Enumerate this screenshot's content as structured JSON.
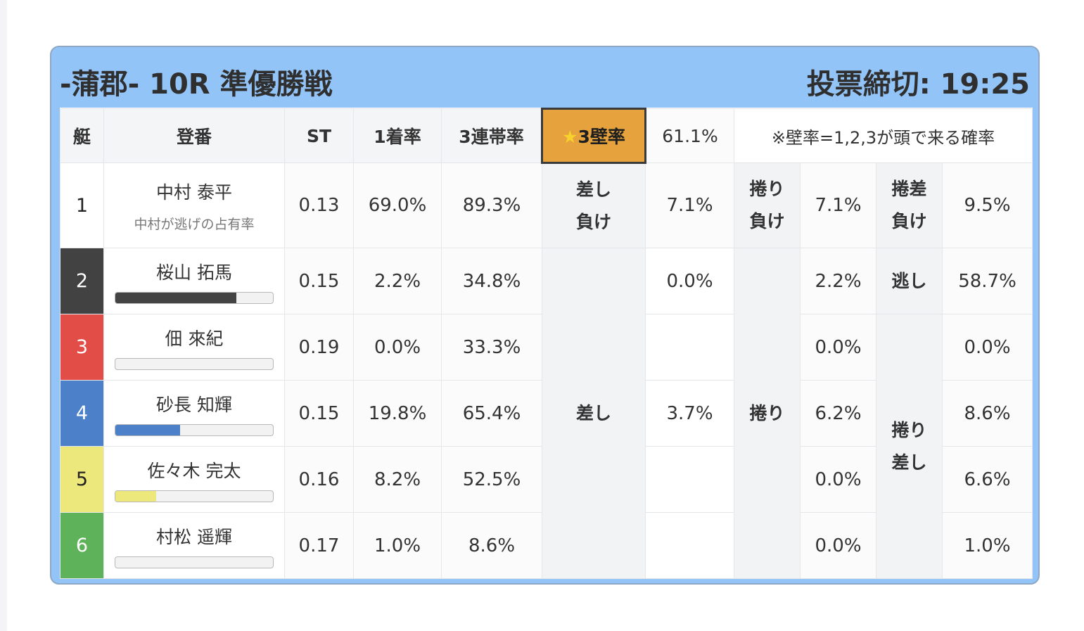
{
  "header": {
    "title": "-蒲郡- 10R 準優勝戦",
    "deadline_label": "投票締切:",
    "deadline_time": "19:25"
  },
  "columns": {
    "boat": "艇",
    "name": "登番",
    "st": "ST",
    "win1": "1着率",
    "top3": "3連帯率",
    "wall_star": "★",
    "wall_label": "3壁率",
    "wall_value": "61.1%",
    "note": "※壁率=1,2,3が頭で来る確率"
  },
  "row1": {
    "number": "1",
    "name": "中村 泰平",
    "sub": "中村が逃げの占有率",
    "st": "0.13",
    "win1": "69.0%",
    "top3": "89.3%",
    "k1_line1": "差し",
    "k1_line2": "負け",
    "v1": "7.1%",
    "k2_line1": "捲り",
    "k2_line2": "負け",
    "v2": "7.1%",
    "k3_line1": "捲差",
    "k3_line2": "負け",
    "v3": "9.5%"
  },
  "kimarite": {
    "sashi": "差し",
    "makuri": "捲り",
    "nige": "逃し",
    "makuri_sashi_line1": "捲り",
    "makuri_sashi_line2": "差し"
  },
  "rows": [
    {
      "number": "2",
      "name": "桜山 拓馬",
      "bar": 0.77,
      "bar_color": "#444444",
      "st": "0.15",
      "win1": "2.2%",
      "top3": "34.8%",
      "sashi": "0.0%",
      "makuri": "2.2%",
      "makuri_sashi": "58.7%"
    },
    {
      "number": "3",
      "name": "佃 來紀",
      "bar": 0.0,
      "bar_color": "#e34d48",
      "st": "0.19",
      "win1": "0.0%",
      "top3": "33.3%",
      "sashi": "",
      "makuri": "0.0%",
      "makuri_sashi": "0.0%"
    },
    {
      "number": "4",
      "name": "砂長 知輝",
      "bar": 0.41,
      "bar_color": "#4c80c8",
      "st": "0.15",
      "win1": "19.8%",
      "top3": "65.4%",
      "sashi": "3.7%",
      "makuri": "6.2%",
      "makuri_sashi": "8.6%"
    },
    {
      "number": "5",
      "name": "佐々木 完太",
      "bar": 0.26,
      "bar_color": "#ede87c",
      "st": "0.16",
      "win1": "8.2%",
      "top3": "52.5%",
      "sashi": "",
      "makuri": "0.0%",
      "makuri_sashi": "6.6%"
    },
    {
      "number": "6",
      "name": "村松 遥輝",
      "bar": 0.0,
      "bar_color": "#5eb35a",
      "st": "0.17",
      "win1": "1.0%",
      "top3": "8.6%",
      "sashi": "",
      "makuri": "0.0%",
      "makuri_sashi": "1.0%"
    }
  ]
}
